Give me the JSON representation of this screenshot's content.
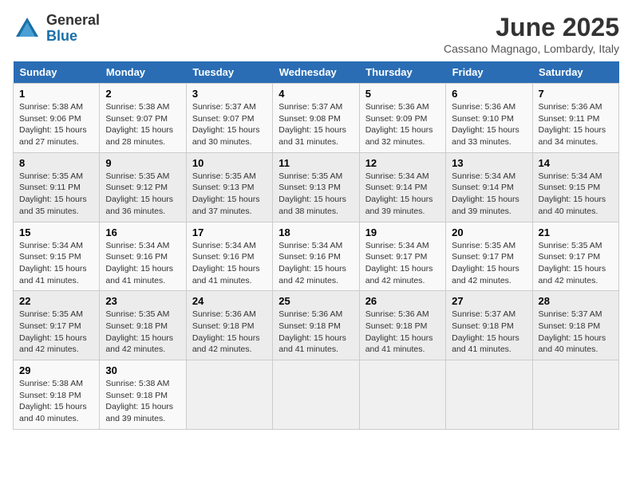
{
  "header": {
    "logo_general": "General",
    "logo_blue": "Blue",
    "title": "June 2025",
    "subtitle": "Cassano Magnago, Lombardy, Italy"
  },
  "weekdays": [
    "Sunday",
    "Monday",
    "Tuesday",
    "Wednesday",
    "Thursday",
    "Friday",
    "Saturday"
  ],
  "weeks": [
    [
      {
        "day": "1",
        "sunrise": "5:38 AM",
        "sunset": "9:06 PM",
        "daylight": "15 hours and 27 minutes."
      },
      {
        "day": "2",
        "sunrise": "5:38 AM",
        "sunset": "9:07 PM",
        "daylight": "15 hours and 28 minutes."
      },
      {
        "day": "3",
        "sunrise": "5:37 AM",
        "sunset": "9:07 PM",
        "daylight": "15 hours and 30 minutes."
      },
      {
        "day": "4",
        "sunrise": "5:37 AM",
        "sunset": "9:08 PM",
        "daylight": "15 hours and 31 minutes."
      },
      {
        "day": "5",
        "sunrise": "5:36 AM",
        "sunset": "9:09 PM",
        "daylight": "15 hours and 32 minutes."
      },
      {
        "day": "6",
        "sunrise": "5:36 AM",
        "sunset": "9:10 PM",
        "daylight": "15 hours and 33 minutes."
      },
      {
        "day": "7",
        "sunrise": "5:36 AM",
        "sunset": "9:11 PM",
        "daylight": "15 hours and 34 minutes."
      }
    ],
    [
      {
        "day": "8",
        "sunrise": "5:35 AM",
        "sunset": "9:11 PM",
        "daylight": "15 hours and 35 minutes."
      },
      {
        "day": "9",
        "sunrise": "5:35 AM",
        "sunset": "9:12 PM",
        "daylight": "15 hours and 36 minutes."
      },
      {
        "day": "10",
        "sunrise": "5:35 AM",
        "sunset": "9:13 PM",
        "daylight": "15 hours and 37 minutes."
      },
      {
        "day": "11",
        "sunrise": "5:35 AM",
        "sunset": "9:13 PM",
        "daylight": "15 hours and 38 minutes."
      },
      {
        "day": "12",
        "sunrise": "5:34 AM",
        "sunset": "9:14 PM",
        "daylight": "15 hours and 39 minutes."
      },
      {
        "day": "13",
        "sunrise": "5:34 AM",
        "sunset": "9:14 PM",
        "daylight": "15 hours and 39 minutes."
      },
      {
        "day": "14",
        "sunrise": "5:34 AM",
        "sunset": "9:15 PM",
        "daylight": "15 hours and 40 minutes."
      }
    ],
    [
      {
        "day": "15",
        "sunrise": "5:34 AM",
        "sunset": "9:15 PM",
        "daylight": "15 hours and 41 minutes."
      },
      {
        "day": "16",
        "sunrise": "5:34 AM",
        "sunset": "9:16 PM",
        "daylight": "15 hours and 41 minutes."
      },
      {
        "day": "17",
        "sunrise": "5:34 AM",
        "sunset": "9:16 PM",
        "daylight": "15 hours and 41 minutes."
      },
      {
        "day": "18",
        "sunrise": "5:34 AM",
        "sunset": "9:16 PM",
        "daylight": "15 hours and 42 minutes."
      },
      {
        "day": "19",
        "sunrise": "5:34 AM",
        "sunset": "9:17 PM",
        "daylight": "15 hours and 42 minutes."
      },
      {
        "day": "20",
        "sunrise": "5:35 AM",
        "sunset": "9:17 PM",
        "daylight": "15 hours and 42 minutes."
      },
      {
        "day": "21",
        "sunrise": "5:35 AM",
        "sunset": "9:17 PM",
        "daylight": "15 hours and 42 minutes."
      }
    ],
    [
      {
        "day": "22",
        "sunrise": "5:35 AM",
        "sunset": "9:17 PM",
        "daylight": "15 hours and 42 minutes."
      },
      {
        "day": "23",
        "sunrise": "5:35 AM",
        "sunset": "9:18 PM",
        "daylight": "15 hours and 42 minutes."
      },
      {
        "day": "24",
        "sunrise": "5:36 AM",
        "sunset": "9:18 PM",
        "daylight": "15 hours and 42 minutes."
      },
      {
        "day": "25",
        "sunrise": "5:36 AM",
        "sunset": "9:18 PM",
        "daylight": "15 hours and 41 minutes."
      },
      {
        "day": "26",
        "sunrise": "5:36 AM",
        "sunset": "9:18 PM",
        "daylight": "15 hours and 41 minutes."
      },
      {
        "day": "27",
        "sunrise": "5:37 AM",
        "sunset": "9:18 PM",
        "daylight": "15 hours and 41 minutes."
      },
      {
        "day": "28",
        "sunrise": "5:37 AM",
        "sunset": "9:18 PM",
        "daylight": "15 hours and 40 minutes."
      }
    ],
    [
      {
        "day": "29",
        "sunrise": "5:38 AM",
        "sunset": "9:18 PM",
        "daylight": "15 hours and 40 minutes."
      },
      {
        "day": "30",
        "sunrise": "5:38 AM",
        "sunset": "9:18 PM",
        "daylight": "15 hours and 39 minutes."
      },
      null,
      null,
      null,
      null,
      null
    ]
  ]
}
